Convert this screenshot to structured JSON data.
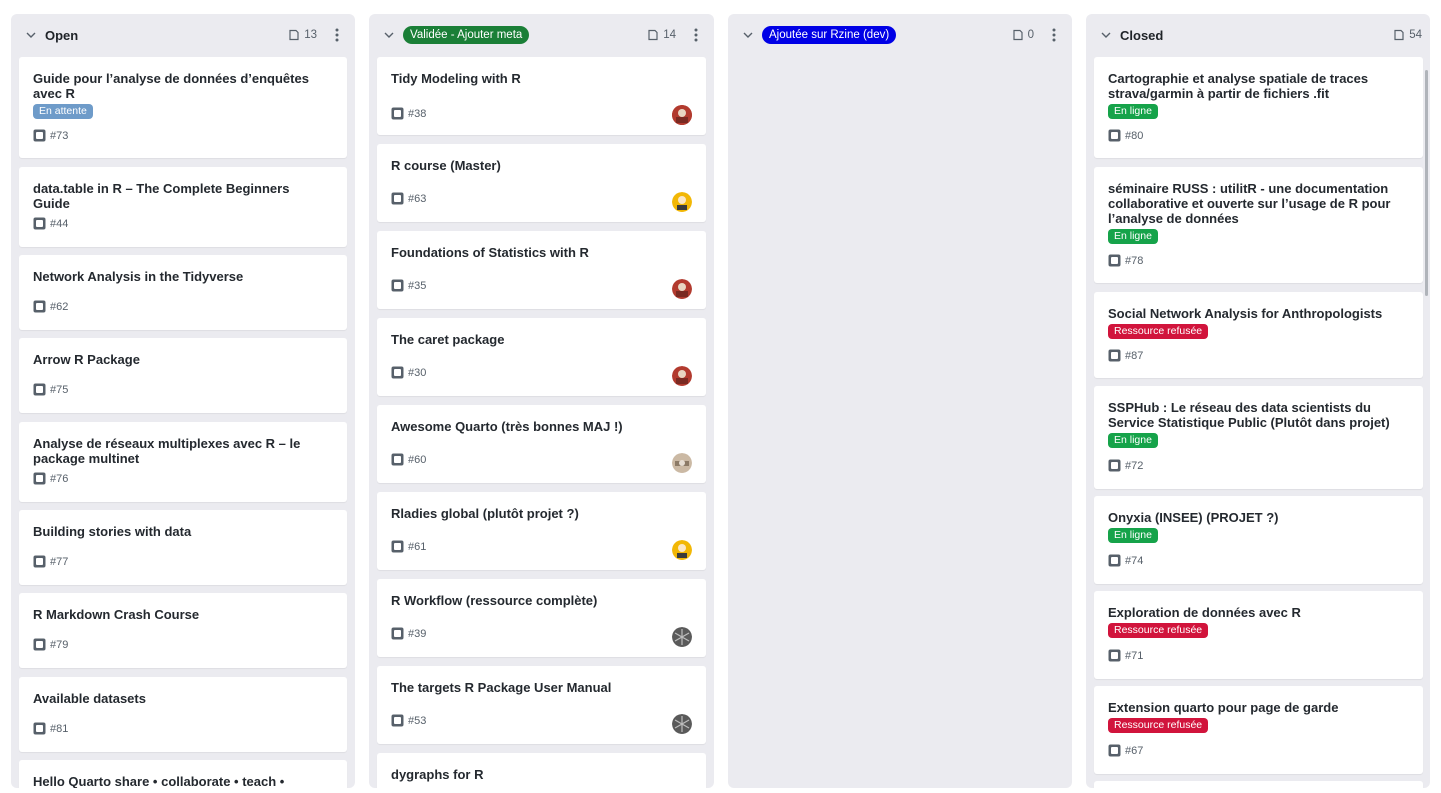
{
  "columns": [
    {
      "title": "Open",
      "pill": null,
      "count": "13",
      "cards": [
        {
          "title": "Guide pour l’analyse de données d’enquêtes avec R",
          "label": "En attente",
          "number": "#73"
        },
        {
          "title": "data.table in R – The Complete Beginners Guide",
          "label": null,
          "number": "#44"
        },
        {
          "title": "Network Analysis in the Tidyverse",
          "label": null,
          "number": "#62"
        },
        {
          "title": "Arrow R Package",
          "label": null,
          "number": "#75"
        },
        {
          "title": "Analyse de réseaux multiplexes avec R – le package multinet",
          "label": null,
          "number": "#76"
        },
        {
          "title": "Building stories with data",
          "label": null,
          "number": "#77"
        },
        {
          "title": "R Markdown Crash Course",
          "label": null,
          "number": "#79"
        },
        {
          "title": "Available datasets",
          "label": null,
          "number": "#81"
        },
        {
          "title": "Hello Quarto share • collaborate • teach •",
          "label": null,
          "number": ""
        }
      ]
    },
    {
      "title": "",
      "pill": "Validée - Ajouter meta",
      "count": "14",
      "cards": [
        {
          "title": "Tidy Modeling with R",
          "number": "#38",
          "avatar": "red-avatar"
        },
        {
          "title": "R course (Master)",
          "number": "#63",
          "avatar": "yellow-avatar"
        },
        {
          "title": "Foundations of Statistics with R",
          "number": "#35",
          "avatar": "red-avatar"
        },
        {
          "title": "The caret package",
          "number": "#30",
          "avatar": "red-avatar"
        },
        {
          "title": "Awesome Quarto (très bonnes MAJ !)",
          "number": "#60",
          "avatar": "beige-avatar"
        },
        {
          "title": "Rladies global (plutôt projet ?)",
          "number": "#61",
          "avatar": "yellow-avatar"
        },
        {
          "title": "R Workflow (ressource complète)",
          "number": "#39",
          "avatar": "gray-avatar"
        },
        {
          "title": "The targets R Package User Manual",
          "number": "#53",
          "avatar": "gray-avatar"
        },
        {
          "title": "dygraphs for R",
          "number": "",
          "avatar": null
        }
      ]
    },
    {
      "title": "",
      "pill": "Ajoutée sur Rzine (dev)",
      "count": "0",
      "cards": []
    },
    {
      "title": "Closed",
      "pill": null,
      "count": "54",
      "cards": [
        {
          "title": "Cartographie et analyse spatiale de traces strava/garmin à partir de fichiers .fit",
          "label": "En ligne",
          "number": "#80"
        },
        {
          "title": "séminaire RUSS : utilitR - une documentation collaborative et ouverte sur l’usage de R pour l’analyse de données",
          "label": "En ligne",
          "number": "#78"
        },
        {
          "title": "Social Network Analysis for Anthropologists",
          "label": "Ressource refusée",
          "number": "#87"
        },
        {
          "title": "SSPHub : Le réseau des data scientists du Service Statistique Public (Plutôt dans projet)",
          "label": "En ligne",
          "number": "#72"
        },
        {
          "title": "Onyxia (INSEE) (PROJET ?)",
          "label": "En ligne",
          "number": "#74"
        },
        {
          "title": "Exploration de données avec R",
          "label": "Ressource refusée",
          "number": "#71"
        },
        {
          "title": "Extension quarto pour page de garde",
          "label": "Ressource refusée",
          "number": "#67"
        }
      ]
    }
  ],
  "colors": {
    "pill_validee": "#1a7f37",
    "pill_ajoutee": "#0000e6",
    "label_en_attente": "#6e9bc9",
    "label_en_ligne": "#16a34a",
    "label_refusee": "#d1143c",
    "column_bg": "#ebebf0"
  },
  "icons": {
    "collapse": "chevron-down-icon",
    "count": "note-icon",
    "menu": "kebab-menu-icon",
    "issue": "issue-draft-icon"
  }
}
